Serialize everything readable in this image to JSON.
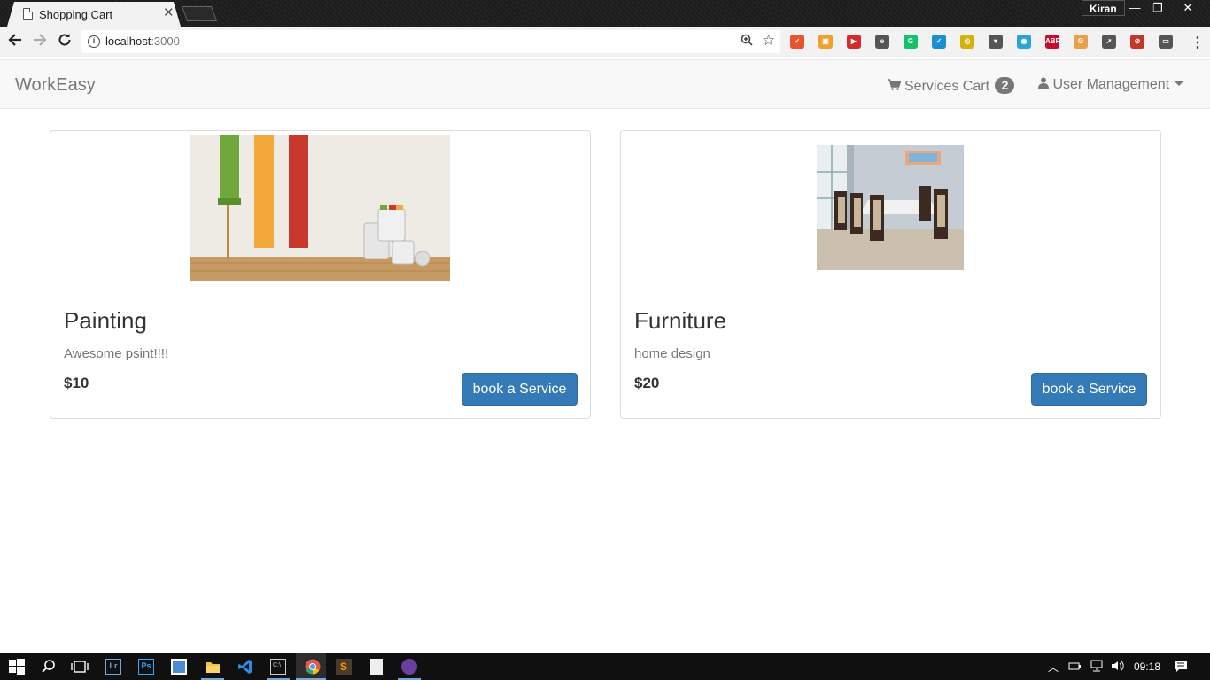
{
  "browser": {
    "tab_title": "Shopping Cart",
    "tab_close": "✕",
    "profile_name": "Kiran",
    "url_host": "localhost",
    "url_port": ":3000",
    "window_controls": [
      "—",
      "❐",
      "✕"
    ],
    "extensions": [
      {
        "name": "extension-red-icon",
        "color": "#e8542d",
        "glyph": "✓"
      },
      {
        "name": "extension-picture-icon",
        "color": "#f0a030",
        "glyph": "▣"
      },
      {
        "name": "extension-playback-icon",
        "color": "#d62b2b",
        "glyph": "▶"
      },
      {
        "name": "evernote-icon",
        "color": "#555555",
        "glyph": "e"
      },
      {
        "name": "grammarly-icon",
        "color": "#15c26b",
        "glyph": "G"
      },
      {
        "name": "extension-check-icon",
        "color": "#1a8fd1",
        "glyph": "✓"
      },
      {
        "name": "extension-circle-icon",
        "color": "#d4b20a",
        "glyph": "◎"
      },
      {
        "name": "pocket-icon",
        "color": "#555555",
        "glyph": "▾"
      },
      {
        "name": "extension-compass-icon",
        "color": "#2aa4d8",
        "glyph": "◉"
      },
      {
        "name": "adblock-plus-icon",
        "color": "#c70d2c",
        "glyph": "ABP"
      },
      {
        "name": "extension-face-icon",
        "color": "#e8a04c",
        "glyph": "ʘ"
      },
      {
        "name": "extension-rocket-icon",
        "color": "#555555",
        "glyph": "➚"
      },
      {
        "name": "extension-block-icon",
        "color": "#c0392b",
        "glyph": "⊘"
      },
      {
        "name": "cast-icon",
        "color": "#555555",
        "glyph": "▭"
      }
    ]
  },
  "navbar": {
    "brand": "WorkEasy",
    "cart_label": "Services Cart",
    "cart_count": "2",
    "user_menu_label": "User Management"
  },
  "services": [
    {
      "title": "Painting",
      "description": "Awesome psint!!!!",
      "price": "$10",
      "button_label": "book a Service"
    },
    {
      "title": "Furniture",
      "description": "home design",
      "price": "$20",
      "button_label": "book a Service"
    }
  ],
  "taskbar": {
    "clock": "09:18",
    "apps": [
      "start-icon",
      "search-icon",
      "task-view-icon",
      "lightroom-icon",
      "photoshop-icon",
      "app-icon",
      "file-explorer-icon",
      "vscode-icon",
      "terminal-icon",
      "chrome-icon",
      "sublime-text-icon",
      "file-icon",
      "app-purple-icon"
    ]
  }
}
